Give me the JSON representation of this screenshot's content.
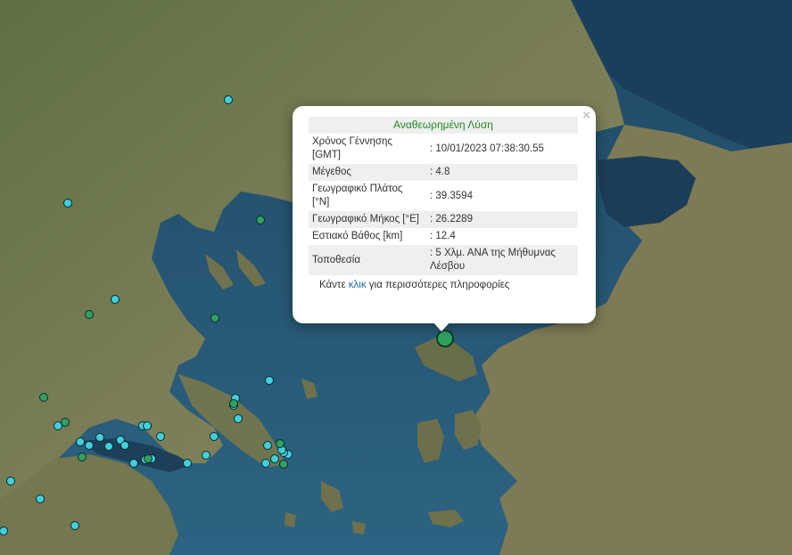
{
  "popup": {
    "title": "Αναθεωρημένη Λύση",
    "close_symbol": "×",
    "rows": [
      {
        "key": "Χρόνος Γέννησης [GMT]",
        "value": ": 10/01/2023 07:38:30.55"
      },
      {
        "key": "Μέγεθος",
        "value": ": 4.8"
      },
      {
        "key": "Γεωγραφικό Πλάτος [°N]",
        "value": ": 39.3594"
      },
      {
        "key": "Γεωγραφικό Μήκος [°E]",
        "value": ": 26.2289"
      },
      {
        "key": "Εστιακό Βάθος [km]",
        "value": ": 12.4"
      },
      {
        "key": "Τοποθεσία",
        "value": ": 5 Χλμ. ΑΝΑ της Μήθυμνας Λέσβου"
      }
    ],
    "more_prefix": "Κάντε ",
    "more_link": "κλικ",
    "more_suffix": " για περισσότερες πληροφορίες"
  },
  "colors": {
    "sea": "#2a5a7a",
    "land": "#6b7a4a",
    "marker_cyan": "#3fd0e0",
    "marker_green": "#2fa060",
    "title_green": "#1f8a1f",
    "link_blue": "#1a6fb0"
  },
  "markers": {
    "cyan_count": 34,
    "green_count": 11
  }
}
